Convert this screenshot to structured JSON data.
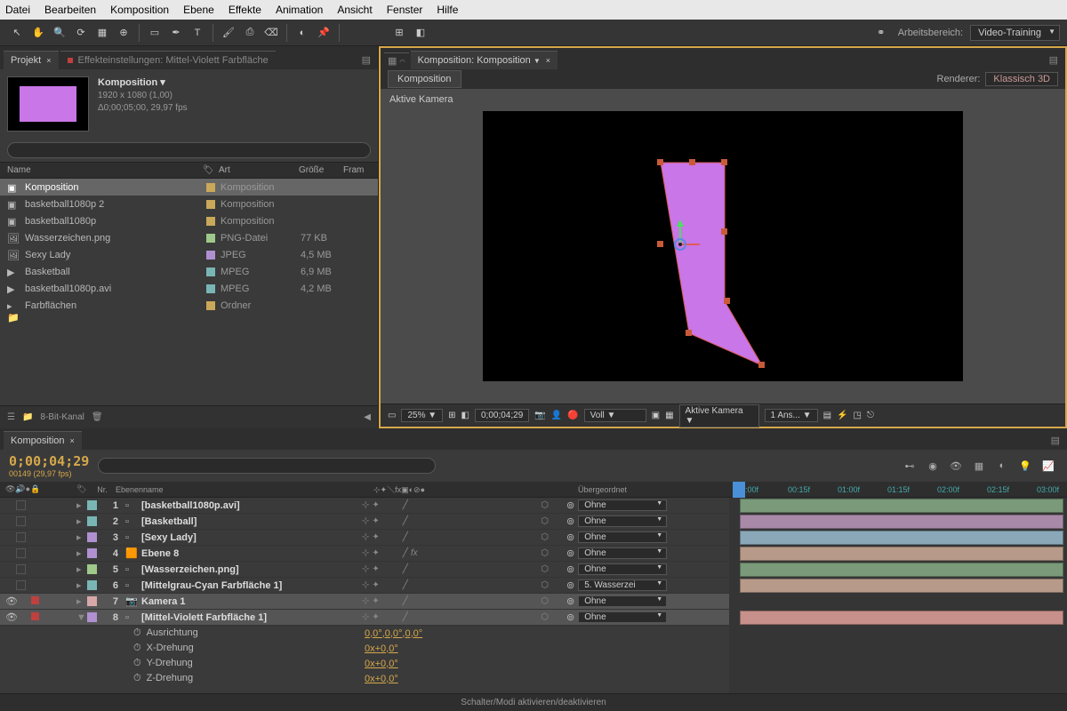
{
  "menu": [
    "Datei",
    "Bearbeiten",
    "Komposition",
    "Ebene",
    "Effekte",
    "Animation",
    "Ansicht",
    "Fenster",
    "Hilfe"
  ],
  "workspace": {
    "label": "Arbeitsbereich:",
    "value": "Video-Training"
  },
  "projectPanel": {
    "tab1": "Projekt",
    "tab2": "Effekteinstellungen: Mittel-Violett Farbfläche",
    "title": "Komposition ▾",
    "meta1": "1920 x 1080 (1,00)",
    "meta2": "Δ0;00;05;00, 29,97 fps",
    "cols": {
      "name": "Name",
      "art": "Art",
      "size": "Größe",
      "fram": "Fram"
    },
    "items": [
      {
        "name": "Komposition",
        "type": "Komposition",
        "size": "",
        "swatch": "#c9a85a",
        "icon": "comp",
        "selected": true
      },
      {
        "name": "basketball1080p 2",
        "type": "Komposition",
        "size": "",
        "swatch": "#c9a85a",
        "icon": "comp"
      },
      {
        "name": "basketball1080p",
        "type": "Komposition",
        "size": "",
        "swatch": "#c9a85a",
        "icon": "comp"
      },
      {
        "name": "Wasserzeichen.png",
        "type": "PNG-Datei",
        "size": "77 KB",
        "swatch": "#9fc98a",
        "icon": "img"
      },
      {
        "name": "Sexy Lady",
        "type": "JPEG",
        "size": "4,5 MB",
        "swatch": "#b090d0",
        "icon": "img"
      },
      {
        "name": "Basketball",
        "type": "MPEG",
        "size": "6,9 MB",
        "swatch": "#7ab5b5",
        "icon": "vid"
      },
      {
        "name": "basketball1080p.avi",
        "type": "MPEG",
        "size": "4,2 MB",
        "swatch": "#7ab5b5",
        "icon": "vid"
      },
      {
        "name": "Farbflächen",
        "type": "Ordner",
        "size": "",
        "swatch": "#c9a85a",
        "icon": "folder"
      }
    ],
    "footer": "8-Bit-Kanal"
  },
  "compPanel": {
    "tabTitle": "Komposition: Komposition",
    "subTab": "Komposition",
    "rendererLabel": "Renderer:",
    "rendererValue": "Klassisch 3D",
    "activeCamera": "Aktive Kamera",
    "footer": {
      "zoom": "25%",
      "time": "0;00;04;29",
      "res": "Voll",
      "view": "Aktive Kamera",
      "views": "1 Ans..."
    }
  },
  "timeline": {
    "tab": "Komposition",
    "timecode": "0;00;04;29",
    "timecodeSub": "00149 (29,97 fps)",
    "cols": {
      "nr": "Nr.",
      "name": "Ebenenname",
      "parent": "Übergeordnet"
    },
    "ruler": [
      ":00f",
      "00:15f",
      "01:00f",
      "01:15f",
      "02:00f",
      "02:15f",
      "03:00f"
    ],
    "layers": [
      {
        "n": 1,
        "name": "[basketball1080p.avi]",
        "sw": "#7ab5b5",
        "parent": "Ohne",
        "bar": "#7a9a7a"
      },
      {
        "n": 2,
        "name": "[Basketball]",
        "sw": "#7ab5b5",
        "parent": "Ohne",
        "bar": "#a88aa8"
      },
      {
        "n": 3,
        "name": "[Sexy Lady]",
        "sw": "#b090d0",
        "parent": "Ohne",
        "bar": "#8aa8b8"
      },
      {
        "n": 4,
        "name": "Ebene 8",
        "sw": "#b090d0",
        "parent": "Ohne",
        "bar": "#b89a8a",
        "fx": true
      },
      {
        "n": 5,
        "name": "[Wasserzeichen.png]",
        "sw": "#9fc98a",
        "parent": "Ohne",
        "bar": "#7a9a7a"
      },
      {
        "n": 6,
        "name": "[Mittelgrau-Cyan Farbfläche 1]",
        "sw": "#7ab5b5",
        "parent": "5. Wasserzei",
        "bar": "#b89a8a"
      },
      {
        "n": 7,
        "name": "Kamera 1",
        "sw": "#d8a8a8",
        "parent": "Ohne",
        "bar": null,
        "selected": true
      },
      {
        "n": 8,
        "name": "[Mittel-Violett Farbfläche 1]",
        "sw": "#b090d0",
        "parent": "Ohne",
        "bar": "#c7908a",
        "selected": true,
        "open": true
      }
    ],
    "props": [
      {
        "name": "Ausrichtung",
        "val": "0,0°,0,0°,0,0°"
      },
      {
        "name": "X-Drehung",
        "val": "0x+0,0°"
      },
      {
        "name": "Y-Drehung",
        "val": "0x+0,0°"
      },
      {
        "name": "Z-Drehung",
        "val": "0x+0,0°"
      }
    ],
    "footer": "Schalter/Modi aktivieren/deaktivieren"
  }
}
